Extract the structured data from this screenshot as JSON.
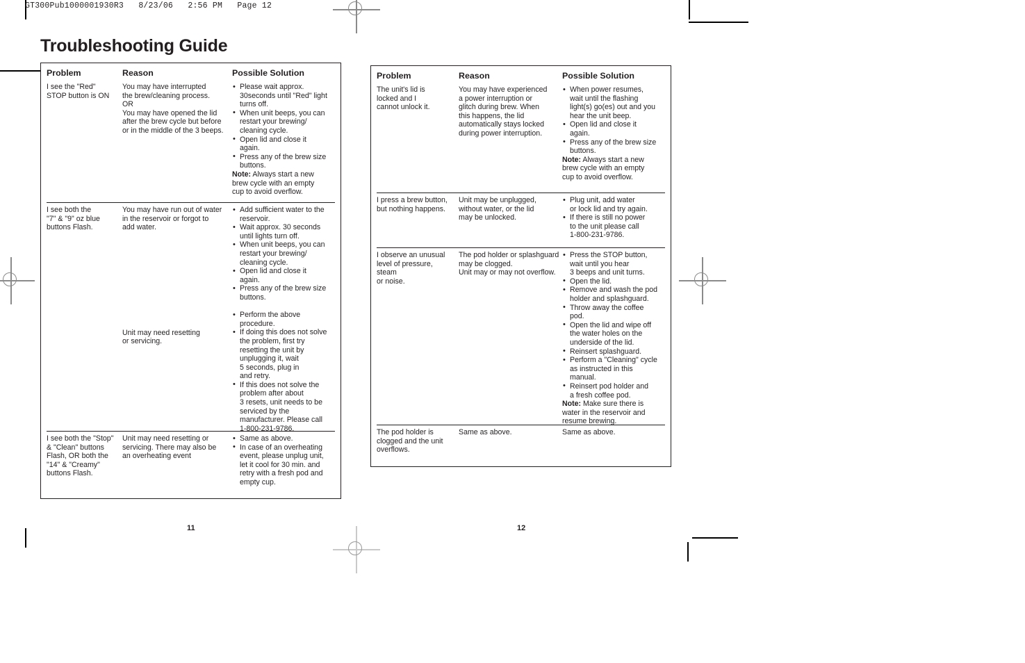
{
  "slug": "GT300Pub1000001930R3   8/23/06   2:56 PM   Page 12",
  "title": "Troubleshooting Guide",
  "columns": [
    "Problem",
    "Reason",
    "Possible Solution"
  ],
  "left_page": {
    "page_number": "11",
    "rows": [
      {
        "problem": "I see the \"Red\"\nSTOP button is ON",
        "reason": "You may have interrupted\nthe brew/cleaning process.\nOR\nYou may have opened the lid\nafter the brew cycle but before\nor in the middle of the 3 beeps.",
        "solution_bullets": [
          "Please wait approx.\n30seconds until \"Red\" light\nturns off.",
          "When unit beeps, you can\nrestart your brewing/\ncleaning cycle.",
          "Open lid and close it\nagain.",
          "Press any of the brew size\nbuttons."
        ],
        "solution_note_label": "Note:",
        "solution_note": " Always start a new\nbrew cycle with an empty\ncup to avoid overflow."
      },
      {
        "problem": "I see both the\n\"7\" & \"9\" oz blue\nbuttons Flash.",
        "reason": "You may have run out of water\nin the reservoir or forgot to\nadd water.",
        "solution_bullets": [
          "Add sufficient water to the\nreservoir.",
          "Wait approx. 30 seconds\nuntil lights turn off.",
          "When unit beeps, you can\nrestart your brewing/\ncleaning cycle.",
          "Open lid and close it\nagain.",
          "Press any of the brew size\nbuttons."
        ],
        "reason_2": "Unit may need resetting\nor servicing.",
        "solution_bullets_2": [
          "Perform the above\nprocedure.",
          "If doing this does not solve\nthe problem, first try\nresetting the unit by\nunplugging it, wait\n5 seconds, plug in\nand retry.",
          "If this does not solve the\nproblem after about\n3 resets, unit needs to be\nserviced by the\nmanufacturer. Please call\n1-800-231-9786."
        ]
      },
      {
        "problem": "I see both the \"Stop\"\n& \"Clean\" buttons\nFlash, OR both the\n\"14\" & \"Creamy\"\nbuttons Flash.",
        "reason": "Unit may need resetting or\nservicing. There may also be\nan overheating event",
        "solution_bullets": [
          "Same as above.",
          "In case of an overheating\nevent, please unplug unit,\nlet it cool for 30 min. and\nretry with a fresh pod and\nempty cup."
        ]
      }
    ]
  },
  "right_page": {
    "page_number": "12",
    "rows": [
      {
        "problem": "The unit's lid is\nlocked and I\ncannot unlock it.",
        "reason": "You may have experienced\na power interruption or\nglitch during brew. When\nthis happens, the lid\nautomatically stays locked\nduring power interruption.",
        "solution_bullets": [
          "When power resumes,\nwait until the flashing\nlight(s) go(es) out and you\nhear the unit beep.",
          "Open lid and close it\nagain.",
          "Press any of the brew size\nbuttons."
        ],
        "solution_note_label": "Note:",
        "solution_note": " Always start a new\nbrew cycle with an empty\ncup to avoid overflow."
      },
      {
        "problem": "I press a brew button,\nbut nothing happens.",
        "reason": "Unit may be unplugged,\nwithout water, or the lid\nmay be unlocked.",
        "solution_bullets": [
          "Plug unit, add water\nor lock lid and try again.",
          "If there is still no power\nto the unit please call\n1-800-231-9786."
        ]
      },
      {
        "problem": "I observe an unusual\nlevel of pressure, steam\nor noise.",
        "reason": "The pod holder or splashguard\nmay be clogged.\nUnit may or may not overflow.",
        "solution_bullets": [
          "Press the STOP button,\nwait until you hear\n3 beeps and unit turns.",
          "Open the lid.",
          "Remove and wash the pod\nholder and splashguard.",
          "Throw away the coffee\npod.",
          "Open the lid and wipe off\nthe water holes on the\nunderside of the lid.",
          "Reinsert splashguard.",
          "Perform a \"Cleaning\" cycle\nas instructed in this\nmanual.",
          "Reinsert pod holder and\na fresh coffee pod."
        ],
        "solution_note_label": "Note:",
        "solution_note": " Make sure there is\nwater in the reservoir and\nresume brewing."
      },
      {
        "problem": "The pod holder is\nclogged and the unit\noverflows.",
        "reason": "Same as above.",
        "solution_plain": "Same as above."
      }
    ]
  }
}
